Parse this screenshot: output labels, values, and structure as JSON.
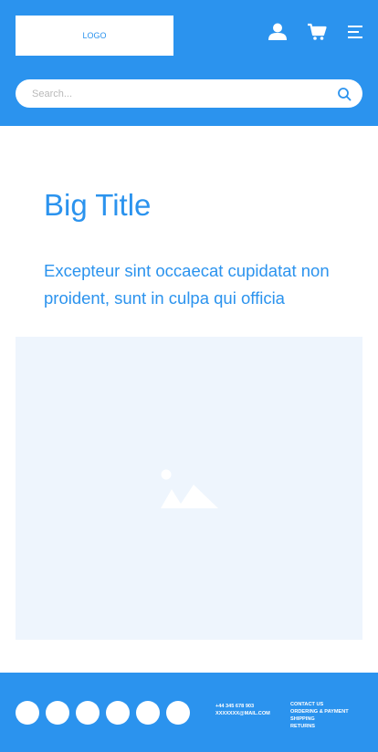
{
  "header": {
    "logo_text": "LOGO",
    "account_icon": "user-icon",
    "cart_icon": "cart-icon",
    "menu_icon": "menu-icon",
    "accent_color": "#2b93ee"
  },
  "search": {
    "placeholder": "Search...",
    "icon": "search-icon"
  },
  "hero": {
    "title": "Big Title",
    "lead": "Excepteur sint occaecat cupidatat non proident, sunt in culpa qui officia"
  },
  "media": {
    "icon": "image-placeholder-icon",
    "background": "#eef5fd"
  },
  "footer": {
    "phone": "+44 345 678 903",
    "email": "XXXXXXX@MAIL.COM",
    "links": [
      "CONTACT US",
      "ORDERING & PAYMENT",
      "SHIPPING",
      "RETURNS"
    ],
    "social_count": 6
  }
}
